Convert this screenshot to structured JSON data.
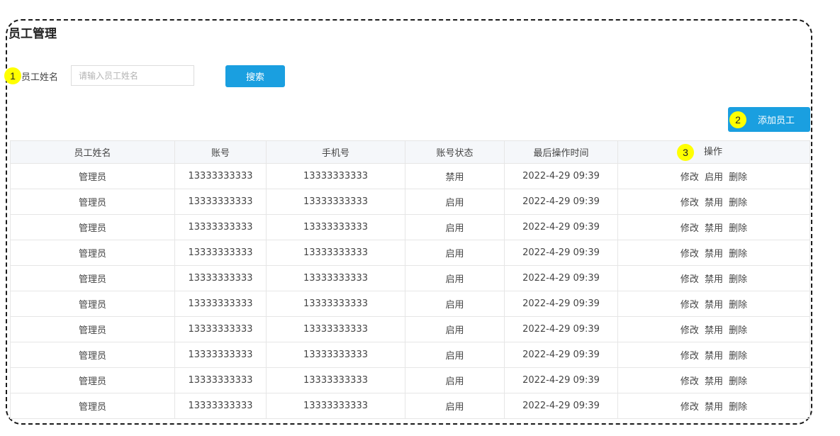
{
  "page": {
    "title": "员工管理"
  },
  "markers": {
    "m1": "1",
    "m2": "2",
    "m3": "3"
  },
  "search": {
    "label": "员工姓名",
    "placeholder": "请输入员工姓名",
    "button_label": "搜索"
  },
  "toolbar": {
    "add_label": "添加员工"
  },
  "table": {
    "columns": [
      "员工姓名",
      "账号",
      "手机号",
      "账号状态",
      "最后操作时间",
      "操作"
    ],
    "rows": [
      {
        "name": "管理员",
        "account": "13333333333",
        "phone": "13333333333",
        "status": "禁用",
        "time": "2022-4-29 09:39",
        "edit": "修改",
        "toggle": "启用",
        "delete": "删除"
      },
      {
        "name": "管理员",
        "account": "13333333333",
        "phone": "13333333333",
        "status": "启用",
        "time": "2022-4-29 09:39",
        "edit": "修改",
        "toggle": "禁用",
        "delete": "删除"
      },
      {
        "name": "管理员",
        "account": "13333333333",
        "phone": "13333333333",
        "status": "启用",
        "time": "2022-4-29 09:39",
        "edit": "修改",
        "toggle": "禁用",
        "delete": "删除"
      },
      {
        "name": "管理员",
        "account": "13333333333",
        "phone": "13333333333",
        "status": "启用",
        "time": "2022-4-29 09:39",
        "edit": "修改",
        "toggle": "禁用",
        "delete": "删除"
      },
      {
        "name": "管理员",
        "account": "13333333333",
        "phone": "13333333333",
        "status": "启用",
        "time": "2022-4-29 09:39",
        "edit": "修改",
        "toggle": "禁用",
        "delete": "删除"
      },
      {
        "name": "管理员",
        "account": "13333333333",
        "phone": "13333333333",
        "status": "启用",
        "time": "2022-4-29 09:39",
        "edit": "修改",
        "toggle": "禁用",
        "delete": "删除"
      },
      {
        "name": "管理员",
        "account": "13333333333",
        "phone": "13333333333",
        "status": "启用",
        "time": "2022-4-29 09:39",
        "edit": "修改",
        "toggle": "禁用",
        "delete": "删除"
      },
      {
        "name": "管理员",
        "account": "13333333333",
        "phone": "13333333333",
        "status": "启用",
        "time": "2022-4-29 09:39",
        "edit": "修改",
        "toggle": "禁用",
        "delete": "删除"
      },
      {
        "name": "管理员",
        "account": "13333333333",
        "phone": "13333333333",
        "status": "启用",
        "time": "2022-4-29 09:39",
        "edit": "修改",
        "toggle": "禁用",
        "delete": "删除"
      },
      {
        "name": "管理员",
        "account": "13333333333",
        "phone": "13333333333",
        "status": "启用",
        "time": "2022-4-29 09:39",
        "edit": "修改",
        "toggle": "禁用",
        "delete": "删除"
      }
    ]
  },
  "colors": {
    "accent": "#1a9fe0",
    "marker": "#ffff00",
    "header_bg": "#f5f7fa"
  }
}
